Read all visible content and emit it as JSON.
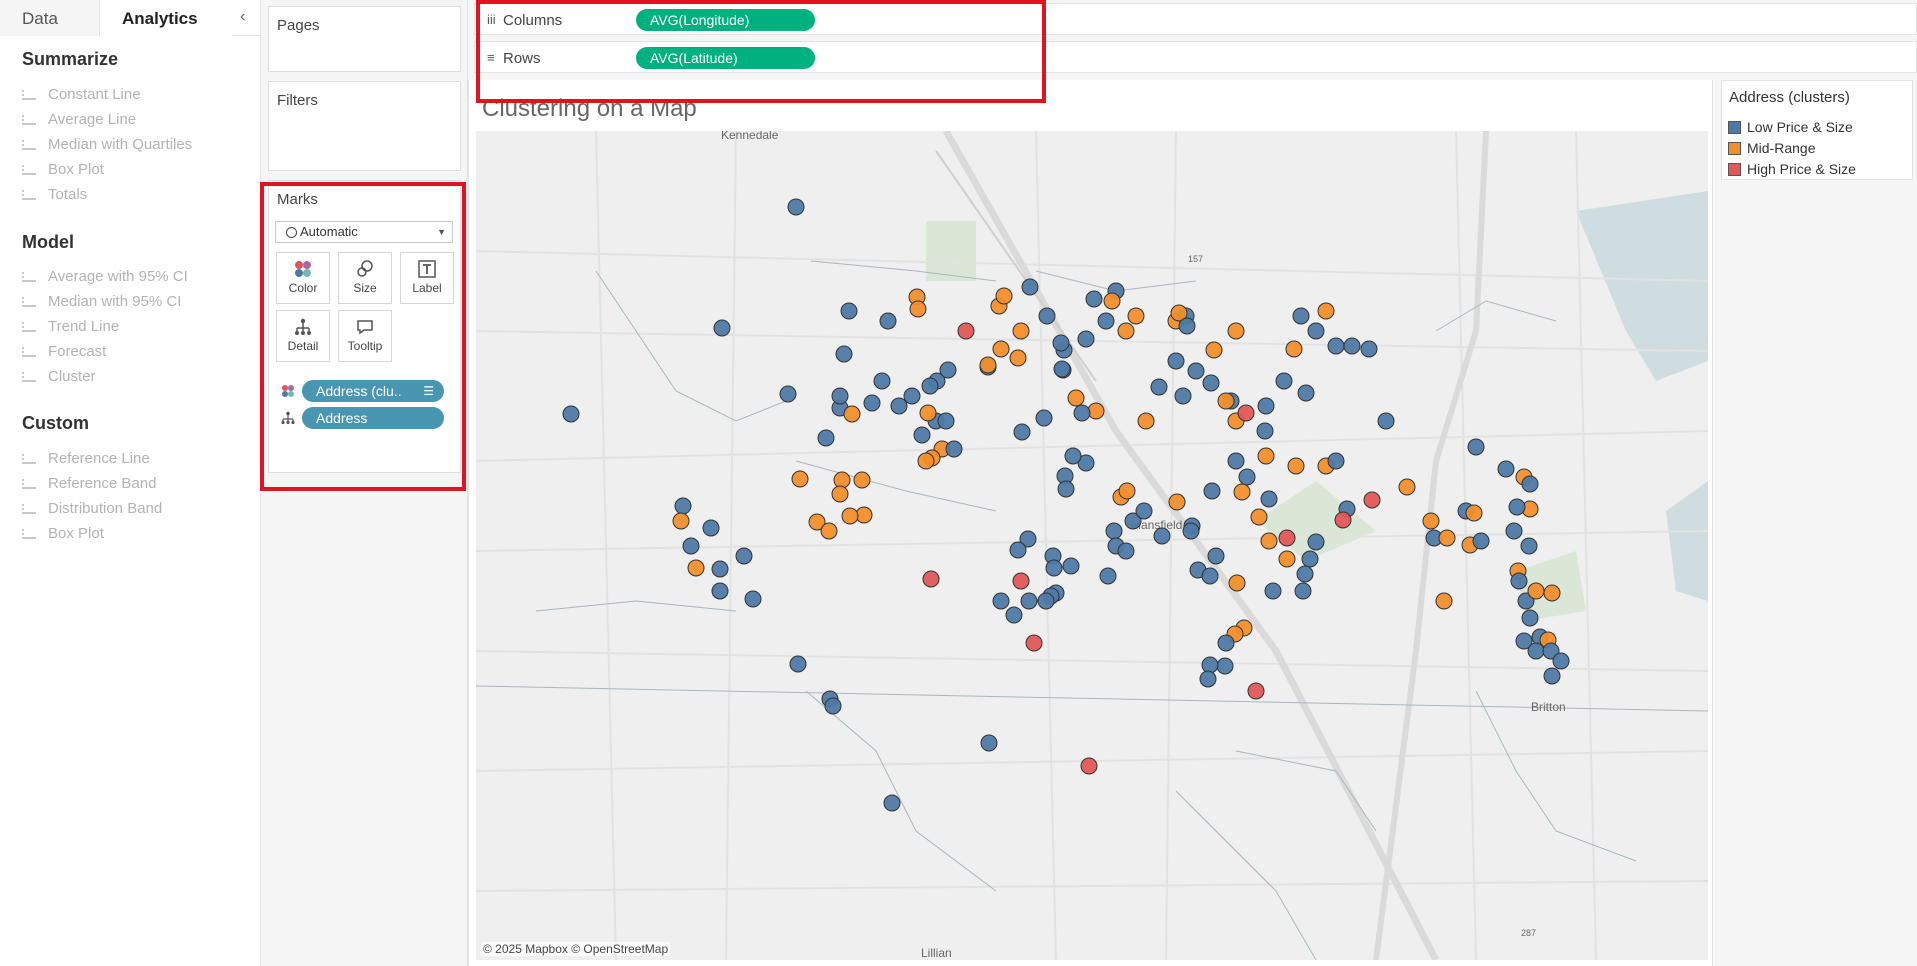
{
  "left_pane": {
    "tabs": [
      {
        "label": "Data"
      },
      {
        "label": "Analytics"
      }
    ],
    "collapse_glyph": "‹",
    "sections": [
      {
        "title": "Summarize",
        "items": [
          "Constant Line",
          "Average Line",
          "Median with Quartiles",
          "Box Plot",
          "Totals"
        ]
      },
      {
        "title": "Model",
        "items": [
          "Average with 95% CI",
          "Median with 95% CI",
          "Trend Line",
          "Forecast",
          "Cluster"
        ]
      },
      {
        "title": "Custom",
        "items": [
          "Reference Line",
          "Reference Band",
          "Distribution Band",
          "Box Plot"
        ]
      }
    ]
  },
  "cards": {
    "pages": "Pages",
    "filters": "Filters",
    "marks": {
      "title": "Marks",
      "type": "Automatic",
      "buttons": [
        "Color",
        "Size",
        "Label",
        "Detail",
        "Tooltip"
      ],
      "pills": [
        {
          "label": "Address (clu..",
          "role": "color"
        },
        {
          "label": "Address",
          "role": "detail"
        }
      ]
    }
  },
  "shelves": {
    "columns": {
      "label": "Columns",
      "pill": "AVG(Longitude)"
    },
    "rows": {
      "label": "Rows",
      "pill": "AVG(Latitude)"
    }
  },
  "sheet": {
    "title": "Clustering on a Map",
    "map_labels": [
      "Kennedale",
      "Mansfield",
      "Britton",
      "Lillian",
      "157",
      "287"
    ],
    "attribution": "© 2025 Mapbox © OpenStreetMap"
  },
  "legend": {
    "title": "Address (clusters)",
    "items": [
      {
        "label": "Low Price & Size",
        "color": "#4e79a7"
      },
      {
        "label": "Mid-Range",
        "color": "#f28e2b"
      },
      {
        "label": "High  Price & Size",
        "color": "#e15759"
      }
    ]
  },
  "colors": {
    "highlight": "#e0141e",
    "pill_green": "#00b180",
    "pill_blue": "#4996b2"
  }
}
